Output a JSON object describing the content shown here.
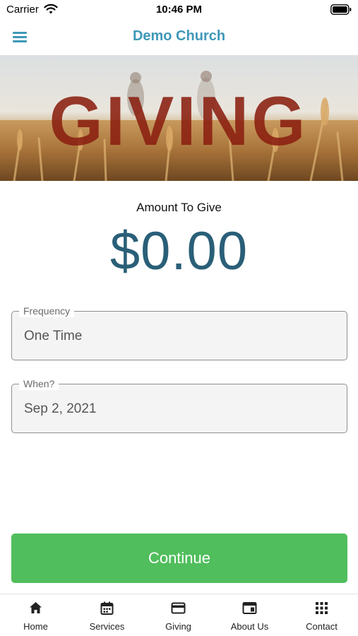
{
  "status_bar": {
    "carrier": "Carrier",
    "time": "10:46 PM",
    "wifi_icon": "wifi-icon",
    "battery_icon": "battery-icon"
  },
  "nav": {
    "title": "Demo Church",
    "menu_icon": "hamburger-menu-icon",
    "accent_color": "#3f98b8"
  },
  "banner": {
    "text": "GIVING",
    "text_color": "#8a1f10"
  },
  "amount": {
    "label": "Amount To Give",
    "value": "$0.00",
    "color": "#2a5f78"
  },
  "form": {
    "frequency": {
      "label": "Frequency",
      "value": "One Time"
    },
    "when": {
      "label": "When?",
      "value": "Sep 2, 2021"
    }
  },
  "continue_button": {
    "label": "Continue",
    "color": "#50be5c"
  },
  "tab_bar": {
    "items": [
      {
        "label": "Home",
        "icon": "home-icon"
      },
      {
        "label": "Services",
        "icon": "calendar-icon"
      },
      {
        "label": "Giving",
        "icon": "credit-card-icon"
      },
      {
        "label": "About Us",
        "icon": "browser-window-icon"
      },
      {
        "label": "Contact",
        "icon": "grid-dots-icon"
      }
    ]
  }
}
